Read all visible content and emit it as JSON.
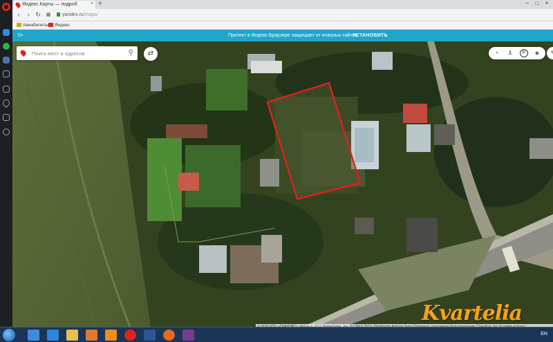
{
  "browser": {
    "tab_title": "Яндекс.Карты — подроб",
    "tab_close": "×",
    "new_tab": "+",
    "url_host": "yandex.ru",
    "url_path": "/maps/",
    "bookmarks": [
      {
        "label": "Авиабилеты",
        "icon": "plane-icon",
        "color": "#d9a41a"
      },
      {
        "label": "Яндекс",
        "icon": "yandex-icon",
        "color": "#e0241b"
      }
    ],
    "window_controls": {
      "minimize": "–",
      "maximize": "□",
      "close": "×"
    }
  },
  "banner": {
    "left_text": "0+",
    "message": "Протект в Яндекс.Браузере защищает от опасных сайтов",
    "action": "УСТАНОВИТЬ",
    "color": "#1fa6c9"
  },
  "map": {
    "search_placeholder": "Поиск мест и адресов",
    "route_icon": "route-icon",
    "tools": [
      "traffic-icon",
      "panorama-icon",
      "parking-icon",
      "layers-icon"
    ],
    "parcel_outline_color": "#e0221a",
    "copyright": "© ООО ИТЦ «СКАНЭКС», Image © 2012 DigitalGlobe, Inc. © CNES 2013, Distribution Astrium Servi  Отключить рекламное брендирование 2 GeoEye, Inc Условия использ"
  },
  "watermark": {
    "text": "Kvartelia",
    "color": "#f7a11a"
  },
  "taskbar": {
    "language": "EN",
    "apps": [
      {
        "name": "ie-icon",
        "color": "#3c8be0"
      },
      {
        "name": "media-player-icon",
        "color": "#2e86de"
      },
      {
        "name": "explorer-icon",
        "color": "#e8c14a"
      },
      {
        "name": "paint-icon",
        "color": "#e07a2e"
      },
      {
        "name": "app-orange-icon",
        "color": "#f08c1a"
      },
      {
        "name": "opera-icon",
        "color": "#e0241b"
      },
      {
        "name": "word-icon",
        "color": "#2b579a"
      },
      {
        "name": "firefox-icon",
        "color": "#e8691f"
      },
      {
        "name": "winrar-icon",
        "color": "#7a3b8f"
      }
    ]
  }
}
